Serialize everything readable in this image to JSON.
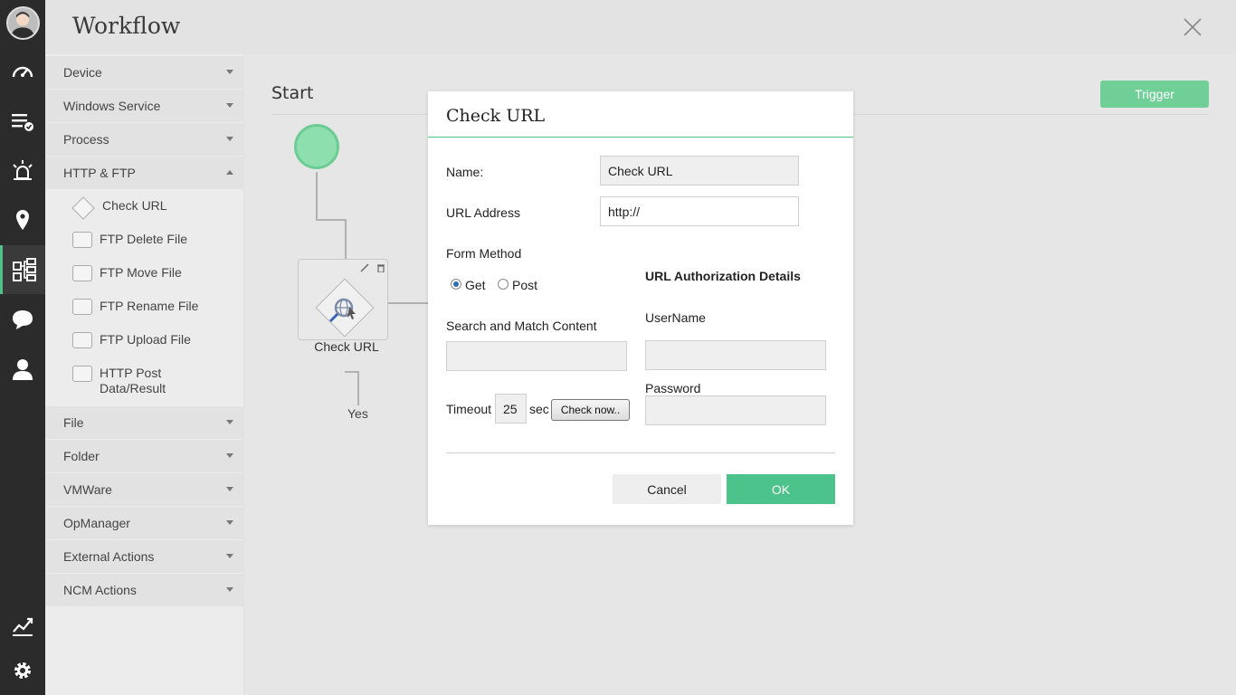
{
  "header": {
    "title": "Workflow"
  },
  "palette": {
    "categories": [
      "Device",
      "Windows Service",
      "Process",
      "HTTP & FTP",
      "File",
      "Folder",
      "VMWare",
      "OpManager",
      "External Actions",
      "NCM Actions"
    ],
    "http_ftp_items": [
      "Check URL",
      "FTP Delete File",
      "FTP Move File",
      "FTP Rename File",
      "FTP Upload File",
      "HTTP Post Data/Result"
    ]
  },
  "canvas": {
    "title": "Start",
    "trigger_label": "Trigger",
    "node_label": "Check URL",
    "yes_label": "Yes"
  },
  "modal": {
    "title": "Check URL",
    "name_label": "Name:",
    "name_value": "Check URL",
    "url_label": "URL Address",
    "url_value": "http://",
    "form_method_label": "Form Method",
    "get_label": "Get",
    "post_label": "Post",
    "selected_method": "Get",
    "auth_heading": "URL Authorization Details",
    "search_label": "Search and Match Content",
    "search_value": "",
    "username_label": "UserName",
    "username_value": "",
    "password_label": "Password",
    "password_value": "",
    "timeout_label": "Timeout",
    "timeout_value": "25",
    "timeout_unit": "sec",
    "check_now_label": "Check now..",
    "cancel_label": "Cancel",
    "ok_label": "OK"
  },
  "colors": {
    "accent": "#4cc38a",
    "trigger": "#6fcf97",
    "rail": "#2b2b2b"
  }
}
